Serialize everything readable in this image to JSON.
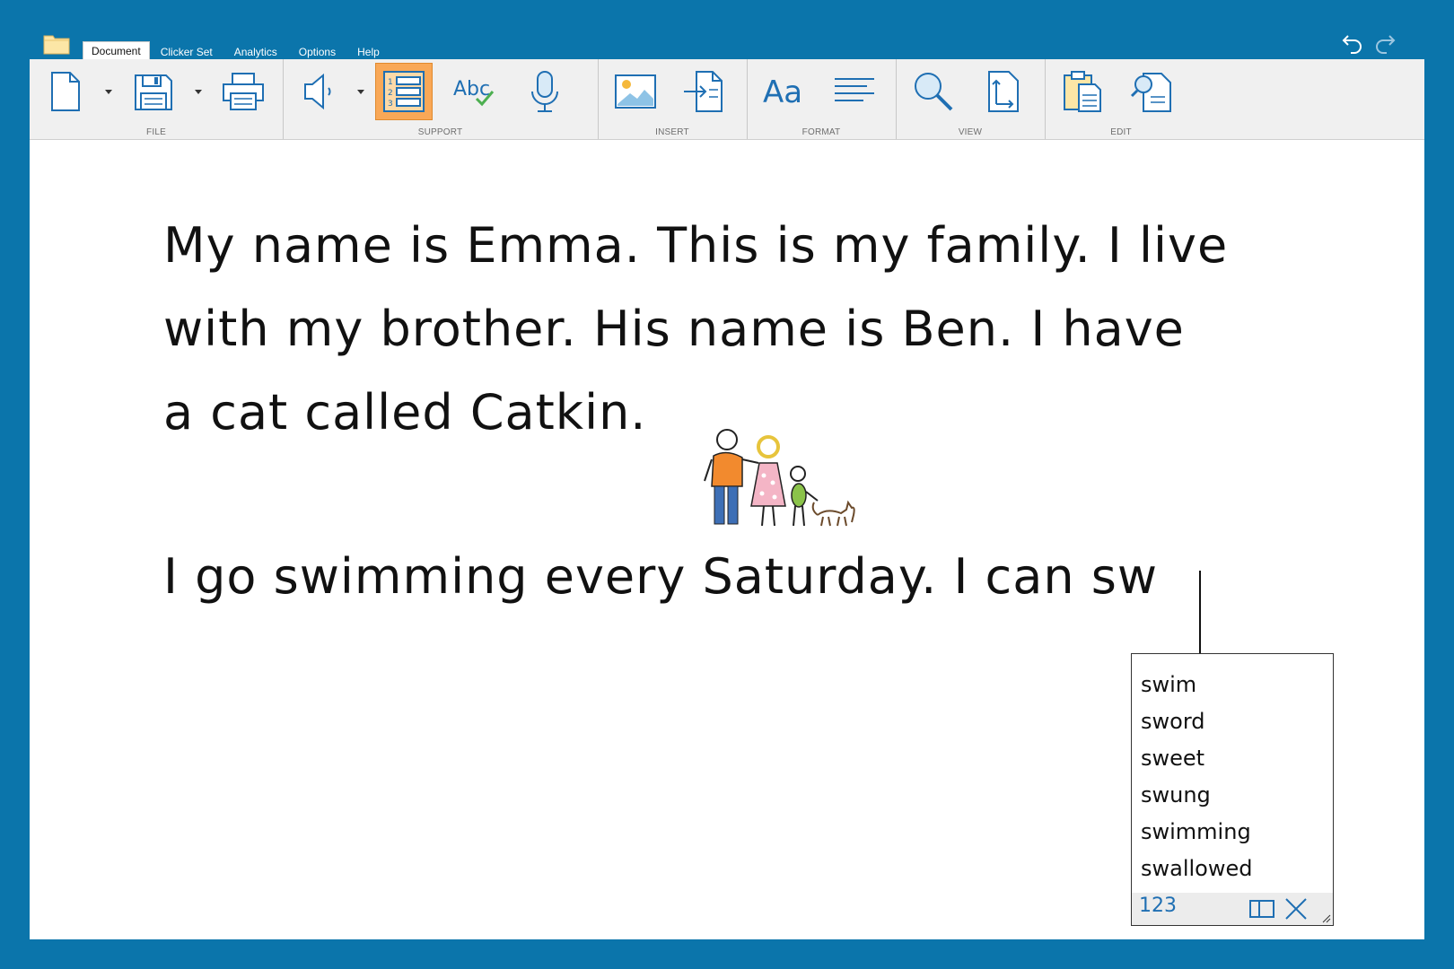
{
  "menu": {
    "tabs": [
      {
        "label": "Document",
        "active": true
      },
      {
        "label": "Clicker Set",
        "active": false
      },
      {
        "label": "Analytics",
        "active": false
      },
      {
        "label": "Options",
        "active": false
      },
      {
        "label": "Help",
        "active": false
      }
    ]
  },
  "ribbon": {
    "groups": {
      "file": "FILE",
      "support": "SUPPORT",
      "insert": "INSERT",
      "format": "FORMAT",
      "view": "VIEW",
      "edit": "EDIT"
    },
    "active_button": "word-list-button",
    "icons": [
      "new-document-icon",
      "save-icon",
      "print-icon",
      "speech-icon",
      "word-list-icon",
      "spellcheck-icon",
      "microphone-icon",
      "insert-picture-icon",
      "insert-file-icon",
      "font-icon",
      "paragraph-icon",
      "zoom-icon",
      "page-size-icon",
      "paste-icon",
      "find-icon"
    ],
    "spellcheck_text": "Abc",
    "font_text": "Aa"
  },
  "document": {
    "paragraphs": [
      [
        "My name is Emma. This is my family. I live",
        "with my brother. His name is Ben. I have",
        "a cat called Catkin."
      ],
      [
        "I go swimming every Saturday. I can sw"
      ]
    ]
  },
  "predictor": {
    "words": [
      "swim",
      "sword",
      "sweet",
      "swung",
      "swimming",
      "swallowed"
    ],
    "numbers_label": "123"
  },
  "colors": {
    "background": "#0B75AB",
    "accent_blue": "#1F6FB3",
    "active_button": "#F9A857"
  }
}
